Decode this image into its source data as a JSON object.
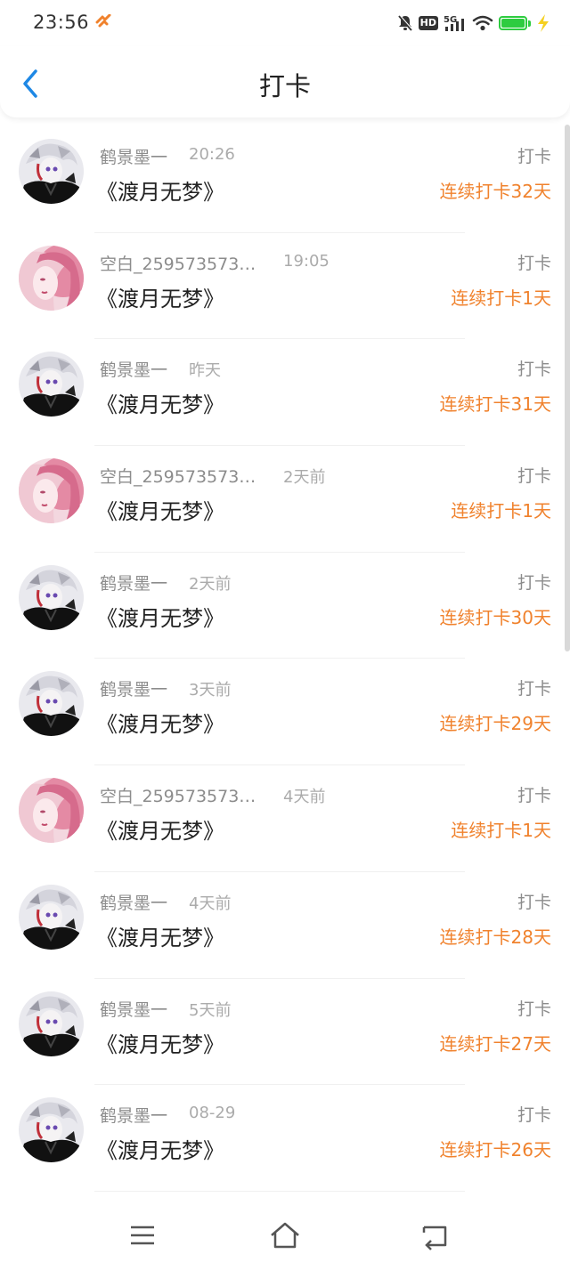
{
  "status_bar": {
    "time": "23:56",
    "network": "5G"
  },
  "header": {
    "title": "打卡"
  },
  "colors": {
    "accent_orange": "#f0822d",
    "back_blue": "#1e88e5"
  },
  "checkins": [
    {
      "user": "鹤景墨一",
      "time": "20:26",
      "book": "《渡月无梦》",
      "type": "打卡",
      "streak": "连续打卡32天",
      "avatar": "dark"
    },
    {
      "user": "空白_259573573…",
      "time": "19:05",
      "book": "《渡月无梦》",
      "type": "打卡",
      "streak": "连续打卡1天",
      "avatar": "pink"
    },
    {
      "user": "鹤景墨一",
      "time": "昨天",
      "book": "《渡月无梦》",
      "type": "打卡",
      "streak": "连续打卡31天",
      "avatar": "dark"
    },
    {
      "user": "空白_259573573…",
      "time": "2天前",
      "book": "《渡月无梦》",
      "type": "打卡",
      "streak": "连续打卡1天",
      "avatar": "pink"
    },
    {
      "user": "鹤景墨一",
      "time": "2天前",
      "book": "《渡月无梦》",
      "type": "打卡",
      "streak": "连续打卡30天",
      "avatar": "dark"
    },
    {
      "user": "鹤景墨一",
      "time": "3天前",
      "book": "《渡月无梦》",
      "type": "打卡",
      "streak": "连续打卡29天",
      "avatar": "dark"
    },
    {
      "user": "空白_259573573…",
      "time": "4天前",
      "book": "《渡月无梦》",
      "type": "打卡",
      "streak": "连续打卡1天",
      "avatar": "pink"
    },
    {
      "user": "鹤景墨一",
      "time": "4天前",
      "book": "《渡月无梦》",
      "type": "打卡",
      "streak": "连续打卡28天",
      "avatar": "dark"
    },
    {
      "user": "鹤景墨一",
      "time": "5天前",
      "book": "《渡月无梦》",
      "type": "打卡",
      "streak": "连续打卡27天",
      "avatar": "dark"
    },
    {
      "user": "鹤景墨一",
      "time": "08-29",
      "book": "《渡月无梦》",
      "type": "打卡",
      "streak": "连续打卡26天",
      "avatar": "dark"
    }
  ],
  "nav": {
    "icons": [
      "menu-icon",
      "home-icon",
      "back-icon"
    ]
  }
}
